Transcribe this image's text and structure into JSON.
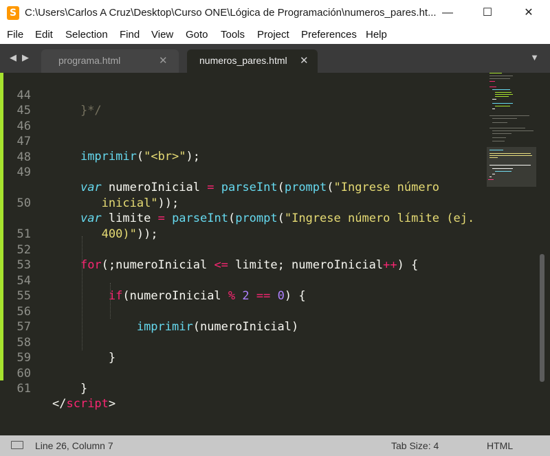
{
  "window": {
    "title": "C:\\Users\\Carlos A Cruz\\Desktop\\Curso ONE\\Lógica de Programación\\numeros_pares.ht...",
    "app_icon": "S",
    "minimize": "—",
    "maximize": "☐",
    "close": "✕"
  },
  "menu": [
    "File",
    "Edit",
    "Selection",
    "Find",
    "View",
    "Goto",
    "Tools",
    "Project",
    "Preferences",
    "Help"
  ],
  "tabs": {
    "nav_left": "◀",
    "nav_right": "▶",
    "items": [
      {
        "label": "programa.html",
        "active": false
      },
      {
        "label": "numeros_pares.html",
        "active": true
      }
    ],
    "close_glyph": "✕",
    "dropdown": "▼"
  },
  "editor": {
    "line_numbers": [
      "44",
      "45",
      "46",
      "47",
      "48",
      "49",
      "",
      "50",
      "",
      "51",
      "52",
      "53",
      "54",
      "55",
      "56",
      "57",
      "58",
      "59",
      "60",
      "61"
    ]
  },
  "status": {
    "position": "Line 26, Column 7",
    "tab_size": "Tab Size: 4",
    "syntax": "HTML"
  },
  "colors": {
    "background": "#272822",
    "keyword": "#f92672",
    "function": "#66d9ef",
    "string": "#e6db74",
    "number": "#ae81ff",
    "comment": "#75715e",
    "gutter_mark": "#a6e22e"
  }
}
